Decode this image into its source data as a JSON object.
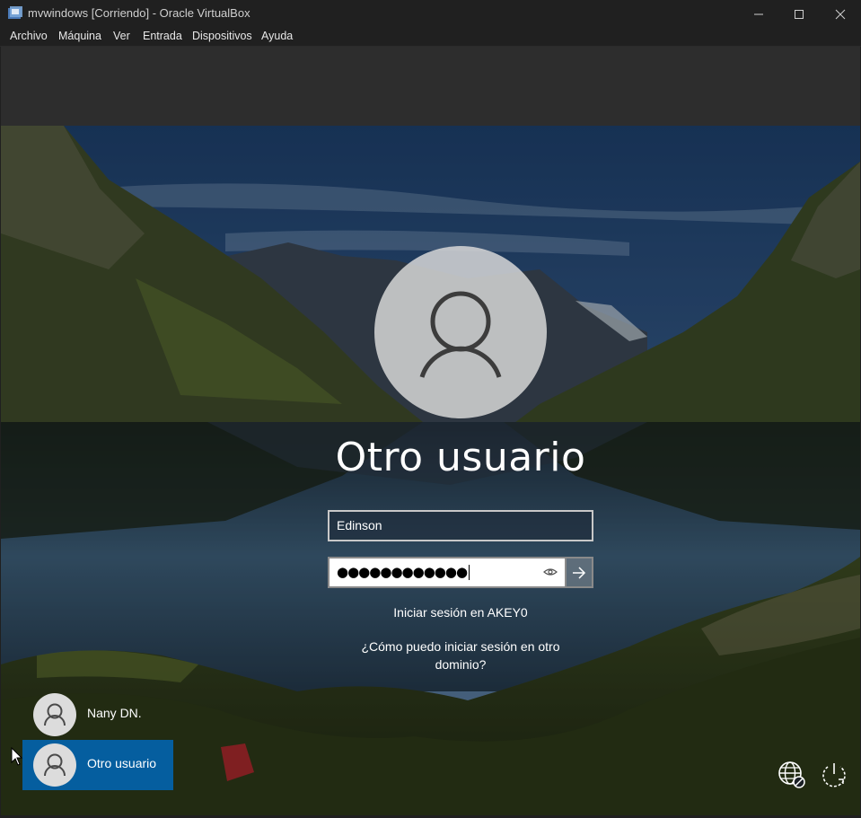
{
  "window": {
    "title": "mvwindows [Corriendo] - Oracle VirtualBox",
    "app_icon": "virtualbox-icon",
    "controls": [
      "minimize-icon",
      "maximize-icon",
      "close-icon"
    ]
  },
  "menu": {
    "items": [
      "Archivo",
      "Máquina",
      "Ver",
      "Entrada",
      "Dispositivos",
      "Ayuda"
    ]
  },
  "login": {
    "display_name": "Otro usuario",
    "username_value": "Edinson",
    "password_mask": "●●●●●●●●●●●●",
    "reveal_icon": "eye-icon",
    "submit_icon": "arrow-right-icon",
    "sign_in_to": "Iniciar sesión en AKEY0",
    "other_domain_link": "¿Cómo puedo iniciar sesión en otro dominio?"
  },
  "user_list": [
    {
      "label": "Nany DN.",
      "selected": false
    },
    {
      "label": "Otro usuario",
      "selected": true
    }
  ],
  "bottom_icons": [
    "network-disconnected-icon",
    "power-icon"
  ],
  "colors": {
    "selected_tile": "#0067b8",
    "titlebar": "#202020",
    "vm_toolbar": "#2d2d2d"
  }
}
